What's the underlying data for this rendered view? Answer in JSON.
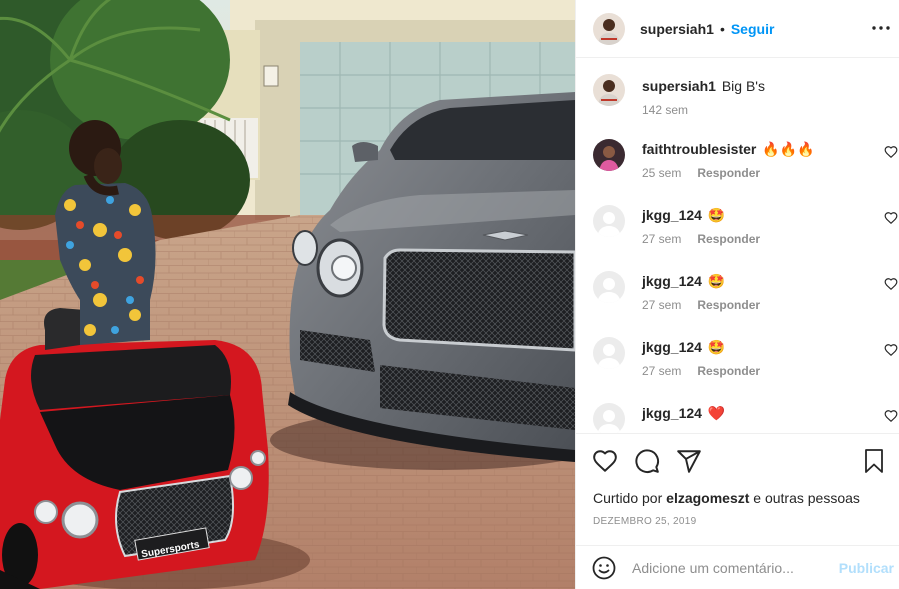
{
  "post": {
    "image_alt": "photo-of-toddler-with-red-toy-car-and-grey-car"
  },
  "header": {
    "username": "supersiah1",
    "separator": "•",
    "follow_label": "Seguir",
    "more_icon": "more-horizontal-icon"
  },
  "caption": {
    "username": "supersiah1",
    "text": "Big B's",
    "age": "142 sem"
  },
  "comments": [
    {
      "username": "faithtroublesister",
      "text": "🔥🔥🔥",
      "age": "25 sem",
      "reply_label": "Responder"
    },
    {
      "username": "jkgg_124",
      "text": "🤩",
      "age": "27 sem",
      "reply_label": "Responder"
    },
    {
      "username": "jkgg_124",
      "text": "🤩",
      "age": "27 sem",
      "reply_label": "Responder"
    },
    {
      "username": "jkgg_124",
      "text": "🤩",
      "age": "27 sem",
      "reply_label": "Responder"
    },
    {
      "username": "jkgg_124",
      "text": "❤️",
      "age": "",
      "reply_label": ""
    }
  ],
  "actions": {
    "like_icon": "heart-icon",
    "comment_icon": "comment-icon",
    "share_icon": "send-icon",
    "save_icon": "bookmark-icon"
  },
  "likes": {
    "prefix": "Curtido por",
    "user": "elzagomeszt",
    "suffix": "e outras pessoas"
  },
  "date": "Dezembro 25, 2019",
  "add_comment": {
    "placeholder": "Adicione um comentário...",
    "post_label": "Publicar",
    "emoji_icon": "smiley-icon"
  },
  "colors": {
    "accent": "#0095f6",
    "text": "#262626",
    "muted": "#8e8e8e",
    "post_disabled": "#b2dffc"
  }
}
